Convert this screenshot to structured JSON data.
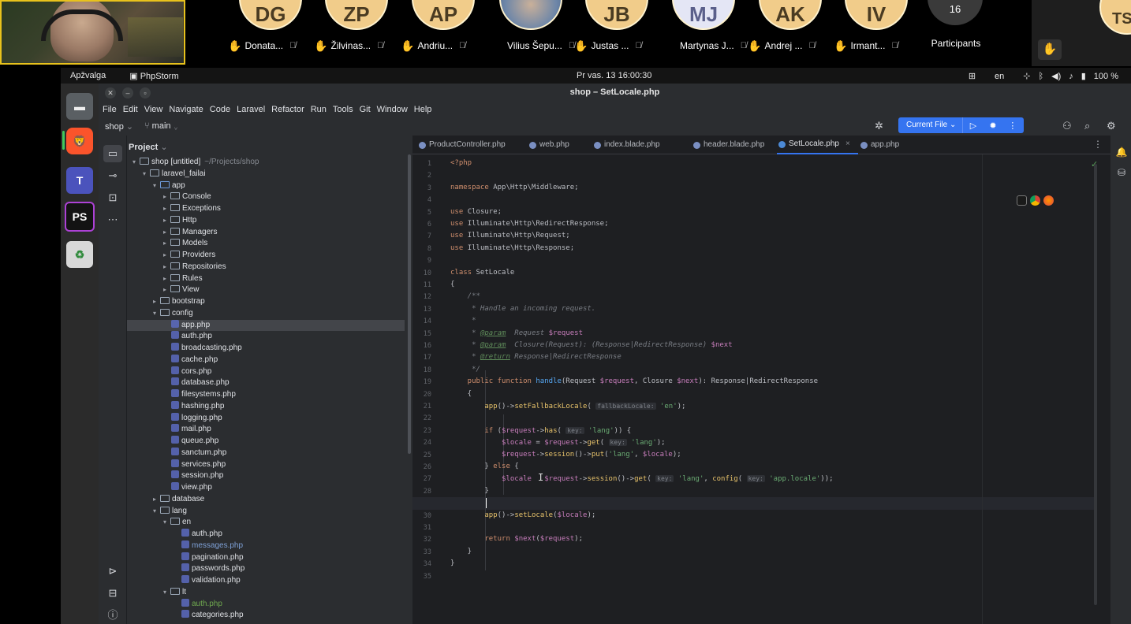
{
  "meeting": {
    "participants": [
      {
        "initials": "DG",
        "name": "Donata...",
        "style": "yellow"
      },
      {
        "initials": "ZP",
        "name": "Žilvinas...",
        "style": "yellow"
      },
      {
        "initials": "AP",
        "name": "Andriu...",
        "style": "yellow"
      },
      {
        "initials": "",
        "name": "Vilius Šepu...",
        "style": "photo",
        "hand": false
      },
      {
        "initials": "JB",
        "name": "Justas ...",
        "style": "yellow"
      },
      {
        "initials": "MJ",
        "name": "Martynas J...",
        "style": "blue",
        "hand": false
      },
      {
        "initials": "AK",
        "name": "Andrej ...",
        "style": "yellow"
      },
      {
        "initials": "IV",
        "name": "Irmant...",
        "style": "yellow"
      }
    ],
    "participant_count": "16",
    "participants_label": "Participants",
    "side_initials": "TS",
    "hand_icon": "✋",
    "mic_icon": "🎙"
  },
  "desktop": {
    "overview": "Apžvalga",
    "app_name": "PhpStorm",
    "clock": "Pr vas. 13  16:00:30",
    "lang": "en",
    "battery": "100 %"
  },
  "ide": {
    "window_title": "shop – SetLocale.php",
    "menu": [
      "File",
      "Edit",
      "View",
      "Navigate",
      "Code",
      "Laravel",
      "Refactor",
      "Run",
      "Tools",
      "Git",
      "Window",
      "Help"
    ],
    "project_name": "shop",
    "branch": "main",
    "run_config": "Current File",
    "panel_title": "Project",
    "tabs": [
      {
        "label": "ProductController.php",
        "active": false
      },
      {
        "label": "web.php",
        "active": false
      },
      {
        "label": "index.blade.php",
        "active": false
      },
      {
        "label": "header.blade.php",
        "active": false
      },
      {
        "label": "SetLocale.php",
        "active": true
      },
      {
        "label": "app.php",
        "active": false
      }
    ],
    "tree": [
      {
        "depth": 0,
        "type": "folder",
        "open": true,
        "label": "shop [untitled]",
        "extra": "~/Projects/shop"
      },
      {
        "depth": 1,
        "type": "folder",
        "open": true,
        "label": "laravel_failai"
      },
      {
        "depth": 2,
        "type": "folder",
        "open": true,
        "label": "app",
        "blue": true
      },
      {
        "depth": 3,
        "type": "folder",
        "open": false,
        "label": "Console"
      },
      {
        "depth": 3,
        "type": "folder",
        "open": false,
        "label": "Exceptions"
      },
      {
        "depth": 3,
        "type": "folder",
        "open": false,
        "label": "Http"
      },
      {
        "depth": 3,
        "type": "folder",
        "open": false,
        "label": "Managers"
      },
      {
        "depth": 3,
        "type": "folder",
        "open": false,
        "label": "Models"
      },
      {
        "depth": 3,
        "type": "folder",
        "open": false,
        "label": "Providers"
      },
      {
        "depth": 3,
        "type": "folder",
        "open": false,
        "label": "Repositories"
      },
      {
        "depth": 3,
        "type": "folder",
        "open": false,
        "label": "Rules"
      },
      {
        "depth": 3,
        "type": "folder",
        "open": false,
        "label": "View"
      },
      {
        "depth": 2,
        "type": "folder",
        "open": false,
        "label": "bootstrap"
      },
      {
        "depth": 2,
        "type": "folder",
        "open": true,
        "label": "config"
      },
      {
        "depth": 3,
        "type": "file",
        "label": "app.php",
        "selected": true
      },
      {
        "depth": 3,
        "type": "file",
        "label": "auth.php"
      },
      {
        "depth": 3,
        "type": "file",
        "label": "broadcasting.php"
      },
      {
        "depth": 3,
        "type": "file",
        "label": "cache.php"
      },
      {
        "depth": 3,
        "type": "file",
        "label": "cors.php"
      },
      {
        "depth": 3,
        "type": "file",
        "label": "database.php"
      },
      {
        "depth": 3,
        "type": "file",
        "label": "filesystems.php"
      },
      {
        "depth": 3,
        "type": "file",
        "label": "hashing.php"
      },
      {
        "depth": 3,
        "type": "file",
        "label": "logging.php"
      },
      {
        "depth": 3,
        "type": "file",
        "label": "mail.php"
      },
      {
        "depth": 3,
        "type": "file",
        "label": "queue.php"
      },
      {
        "depth": 3,
        "type": "file",
        "label": "sanctum.php"
      },
      {
        "depth": 3,
        "type": "file",
        "label": "services.php"
      },
      {
        "depth": 3,
        "type": "file",
        "label": "session.php"
      },
      {
        "depth": 3,
        "type": "file",
        "label": "view.php"
      },
      {
        "depth": 2,
        "type": "folder",
        "open": false,
        "label": "database"
      },
      {
        "depth": 2,
        "type": "folder",
        "open": true,
        "label": "lang"
      },
      {
        "depth": 3,
        "type": "folder",
        "open": true,
        "label": "en"
      },
      {
        "depth": 4,
        "type": "file",
        "label": "auth.php"
      },
      {
        "depth": 4,
        "type": "file",
        "label": "messages.php",
        "color": "blue"
      },
      {
        "depth": 4,
        "type": "file",
        "label": "pagination.php"
      },
      {
        "depth": 4,
        "type": "file",
        "label": "passwords.php"
      },
      {
        "depth": 4,
        "type": "file",
        "label": "validation.php"
      },
      {
        "depth": 3,
        "type": "folder",
        "open": true,
        "label": "lt"
      },
      {
        "depth": 4,
        "type": "file",
        "label": "auth.php",
        "color": "green"
      },
      {
        "depth": 4,
        "type": "file",
        "label": "categories.php"
      }
    ],
    "code_lines": [
      [
        [
          "kw",
          "<?php"
        ]
      ],
      [],
      [
        [
          "kw",
          "namespace "
        ],
        [
          "plain",
          "App\\Http\\Middleware;"
        ]
      ],
      [],
      [
        [
          "kw",
          "use "
        ],
        [
          "plain",
          "Closure;"
        ]
      ],
      [
        [
          "kw",
          "use "
        ],
        [
          "plain",
          "Illuminate\\Http\\RedirectResponse;"
        ]
      ],
      [
        [
          "kw",
          "use "
        ],
        [
          "plain",
          "Illuminate\\Http\\Request;"
        ]
      ],
      [
        [
          "kw",
          "use "
        ],
        [
          "plain",
          "Illuminate\\Http\\Response;"
        ]
      ],
      [],
      [
        [
          "kw",
          "class "
        ],
        [
          "plain",
          "SetLocale"
        ]
      ],
      [
        [
          "plain",
          "{"
        ]
      ],
      [
        [
          "cmt",
          "    /**"
        ]
      ],
      [
        [
          "cmt",
          "     * Handle an incoming request."
        ]
      ],
      [
        [
          "cmt",
          "     *"
        ]
      ],
      [
        [
          "cmt",
          "     * "
        ],
        [
          "doctag",
          "@param"
        ],
        [
          "cmt",
          "  Request "
        ],
        [
          "var",
          "$request"
        ]
      ],
      [
        [
          "cmt",
          "     * "
        ],
        [
          "doctag",
          "@param"
        ],
        [
          "cmt",
          "  Closure(Request): (Response|RedirectResponse) "
        ],
        [
          "var",
          "$next"
        ]
      ],
      [
        [
          "cmt",
          "     * "
        ],
        [
          "doctag",
          "@return"
        ],
        [
          "cmt",
          " Response|RedirectResponse"
        ]
      ],
      [
        [
          "cmt",
          "     */"
        ]
      ],
      [
        [
          "kw",
          "    public function "
        ],
        [
          "fn",
          "handle"
        ],
        [
          "plain",
          "(Request "
        ],
        [
          "var",
          "$request"
        ],
        [
          "plain",
          ", Closure "
        ],
        [
          "var",
          "$next"
        ],
        [
          "plain",
          "): Response|RedirectResponse"
        ]
      ],
      [
        [
          "plain",
          "    {"
        ]
      ],
      [
        [
          "plain",
          "        "
        ],
        [
          "fnc",
          "app"
        ],
        [
          "plain",
          "()->"
        ],
        [
          "fnc",
          "setFallbackLocale"
        ],
        [
          "plain",
          "( "
        ],
        [
          "hint",
          "fallbackLocale:"
        ],
        [
          "str",
          " 'en'"
        ],
        [
          "plain",
          ");"
        ]
      ],
      [],
      [
        [
          "kw",
          "        if "
        ],
        [
          "plain",
          "("
        ],
        [
          "var",
          "$request"
        ],
        [
          "plain",
          "->"
        ],
        [
          "fnc",
          "has"
        ],
        [
          "plain",
          "( "
        ],
        [
          "hint",
          "key:"
        ],
        [
          "str",
          " 'lang'"
        ],
        [
          "plain",
          ")) {"
        ]
      ],
      [
        [
          "plain",
          "            "
        ],
        [
          "var",
          "$locale"
        ],
        [
          "plain",
          " = "
        ],
        [
          "var",
          "$request"
        ],
        [
          "plain",
          "->"
        ],
        [
          "fnc",
          "get"
        ],
        [
          "plain",
          "( "
        ],
        [
          "hint",
          "key:"
        ],
        [
          "str",
          " 'lang'"
        ],
        [
          "plain",
          ");"
        ]
      ],
      [
        [
          "plain",
          "            "
        ],
        [
          "var",
          "$request"
        ],
        [
          "plain",
          "->"
        ],
        [
          "fnc",
          "session"
        ],
        [
          "plain",
          "()->"
        ],
        [
          "fnc",
          "put"
        ],
        [
          "plain",
          "("
        ],
        [
          "str",
          "'lang'"
        ],
        [
          "plain",
          ", "
        ],
        [
          "var",
          "$locale"
        ],
        [
          "plain",
          ");"
        ]
      ],
      [
        [
          "plain",
          "        } "
        ],
        [
          "kw",
          "else "
        ],
        [
          "plain",
          "{"
        ]
      ],
      [
        [
          "plain",
          "            "
        ],
        [
          "var",
          "$locale"
        ],
        [
          "plain",
          "   "
        ],
        [
          "var",
          "$request"
        ],
        [
          "plain",
          "->"
        ],
        [
          "fnc",
          "session"
        ],
        [
          "plain",
          "()->"
        ],
        [
          "fnc",
          "get"
        ],
        [
          "plain",
          "( "
        ],
        [
          "hint",
          "key:"
        ],
        [
          "str",
          " 'lang'"
        ],
        [
          "plain",
          ", "
        ],
        [
          "fnc",
          "config"
        ],
        [
          "plain",
          "( "
        ],
        [
          "hint",
          "key:"
        ],
        [
          "str",
          " 'app.locale'"
        ],
        [
          "plain",
          "));"
        ]
      ],
      [
        [
          "plain",
          "        }"
        ]
      ],
      [],
      [
        [
          "plain",
          "        "
        ],
        [
          "fnc",
          "app"
        ],
        [
          "plain",
          "()->"
        ],
        [
          "fnc",
          "setLocale"
        ],
        [
          "plain",
          "("
        ],
        [
          "var",
          "$locale"
        ],
        [
          "plain",
          ");"
        ]
      ],
      [],
      [
        [
          "kw",
          "        return "
        ],
        [
          "var",
          "$next"
        ],
        [
          "plain",
          "("
        ],
        [
          "var",
          "$request"
        ],
        [
          "plain",
          ");"
        ]
      ],
      [
        [
          "plain",
          "    }"
        ]
      ],
      [
        [
          "plain",
          "}"
        ]
      ],
      []
    ],
    "current_line": 29
  }
}
